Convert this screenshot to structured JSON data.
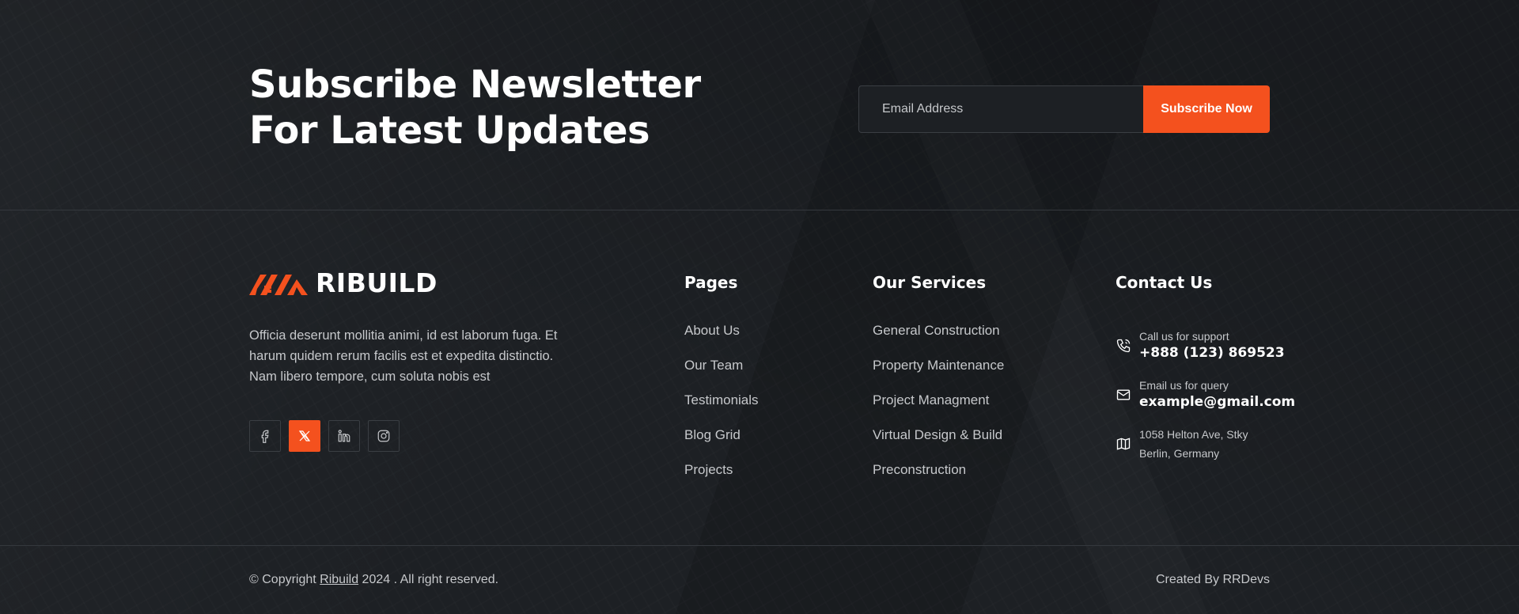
{
  "newsletter": {
    "title": "Subscribe Newsletter For Latest Updates",
    "email_placeholder": "Email Address",
    "submit_label": "Subscribe Now"
  },
  "brand": {
    "name": "RIBUILD",
    "description": "Officia deserunt mollitia animi, id est laborum fuga. Et harum quidem rerum facilis est et expedita distinctio. Nam libero tempore, cum soluta nobis est",
    "social": [
      {
        "icon": "facebook-icon",
        "active": false
      },
      {
        "icon": "x-twitter-icon",
        "active": true
      },
      {
        "icon": "linkedin-icon",
        "active": false
      },
      {
        "icon": "instagram-icon",
        "active": false
      }
    ]
  },
  "pages": {
    "title": "Pages",
    "links": [
      "About Us",
      "Our Team",
      "Testimonials",
      "Blog Grid",
      "Projects"
    ]
  },
  "services": {
    "title": "Our Services",
    "links": [
      "General Construction",
      "Property Maintenance",
      "Project Managment",
      "Virtual Design & Build",
      "Preconstruction"
    ]
  },
  "contact": {
    "title": "Contact Us",
    "phone_label": "Call us for support",
    "phone": "+888 (123) 869523",
    "email_label": "Email us for query",
    "email": "example@gmail.com",
    "address_line1": "1058 Helton Ave, Stky",
    "address_line2": "Berlin, Germany"
  },
  "bottom": {
    "copyright_prefix": "© Copyright",
    "copyright_link": "Ribuild",
    "copyright_suffix": "2024 . All right reserved.",
    "credit": "Created By RRDevs"
  },
  "colors": {
    "background": "#1d2024",
    "accent": "#f4511e",
    "text": "#c6c8cb",
    "heading": "#ffffff"
  }
}
